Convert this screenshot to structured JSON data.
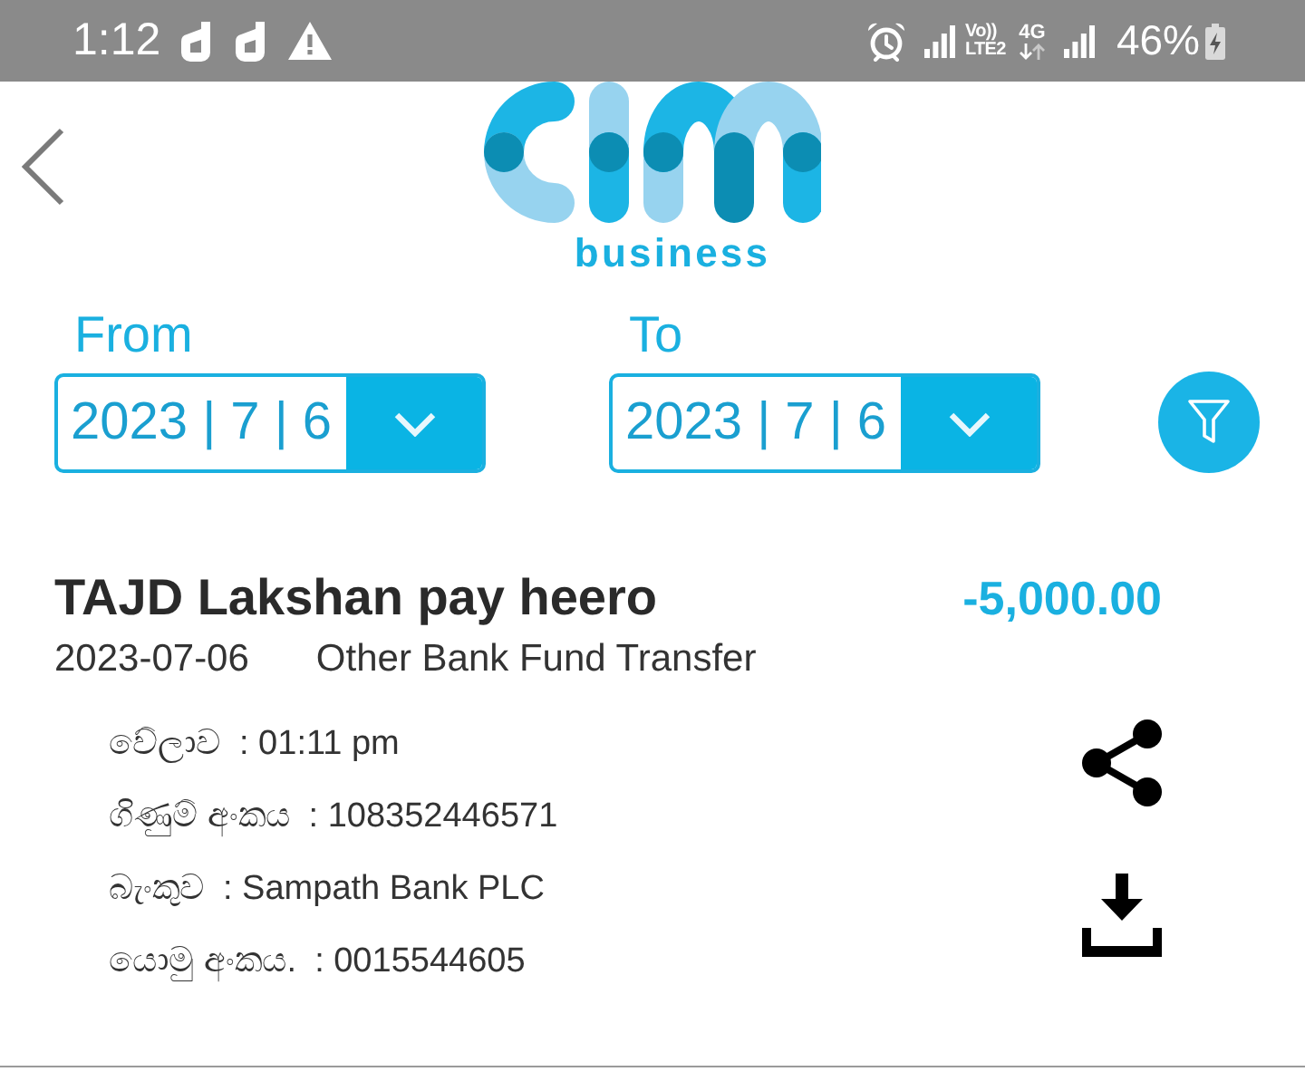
{
  "status_bar": {
    "time": "1:12",
    "notifications": [
      {
        "kind": "app"
      },
      {
        "kind": "app"
      },
      {
        "kind": "warning"
      }
    ],
    "volte": "Vo))",
    "lte": "LTE2",
    "network": "4G",
    "battery": "46%",
    "charging": true
  },
  "header": {
    "brand": "business"
  },
  "date_range": [
    {
      "label": "From",
      "value": "2023 | 7 | 6"
    },
    {
      "label": "To",
      "value": "2023 | 7 | 6"
    }
  ],
  "transaction": {
    "title": "TAJD Lakshan pay heero",
    "amount": "-5,000.00",
    "date": "2023-07-06",
    "type": "Other Bank Fund Transfer",
    "details": [
      {
        "label": "වේලාව",
        "value": ": 01:11 pm"
      },
      {
        "label": "ගිණුම් අංකය",
        "value": ": 108352446571"
      },
      {
        "label": "බැංකුව",
        "value": ": Sampath Bank PLC"
      },
      {
        "label": "යොමු අංකය.",
        "value": ": 0015544605"
      }
    ]
  }
}
